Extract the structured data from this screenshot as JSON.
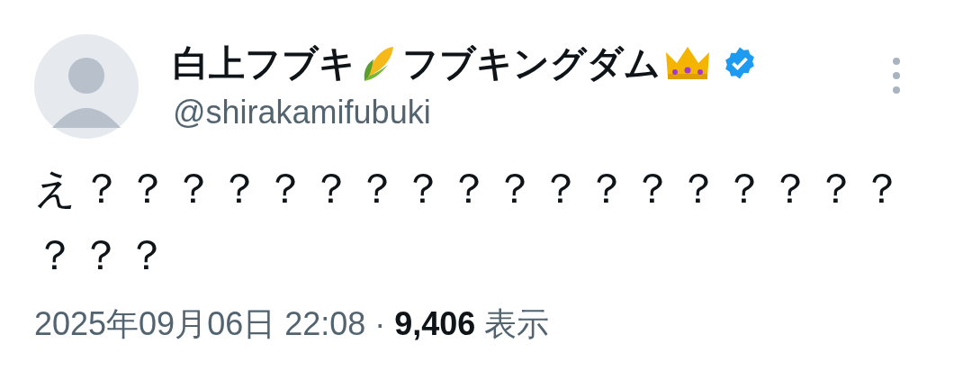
{
  "author": {
    "name_parts": [
      "白上フブキ",
      "フブキングダム"
    ],
    "verified": true,
    "handle": "@shirakamifubuki"
  },
  "post": {
    "text": "え？？？？？？？？？？？？？？？？？？？？？"
  },
  "meta": {
    "timestamp": "2025年09月06日 22:08",
    "separator": "·",
    "views_count": "9,406",
    "views_label": "表示"
  }
}
